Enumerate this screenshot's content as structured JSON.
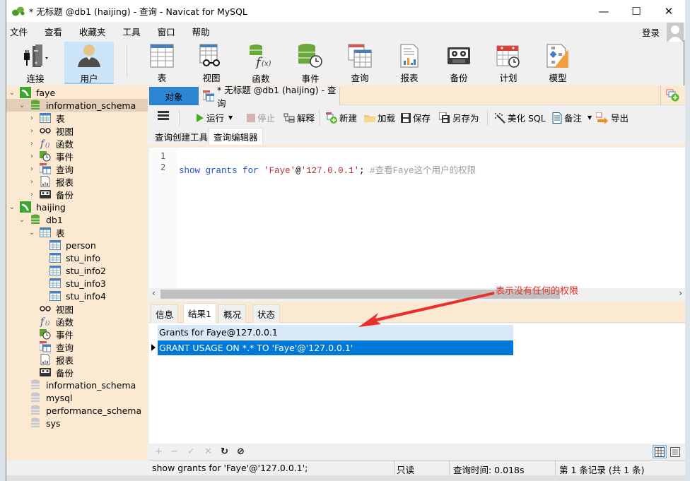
{
  "window": {
    "title": "* 无标题 @db1 (haijing) - 查询 - Navicat for MySQL",
    "controls": {
      "minimize": "—",
      "maximize": "☐",
      "close": "✕"
    }
  },
  "menubar": {
    "items": [
      "文件",
      "查看",
      "收藏夹",
      "工具",
      "窗口",
      "帮助"
    ],
    "login": "登录"
  },
  "toolbar": {
    "buttons": [
      {
        "label": "连接",
        "icon": "connection-icon"
      },
      {
        "label": "用户",
        "icon": "user-icon",
        "active": true
      },
      {
        "label": "表",
        "icon": "table-icon"
      },
      {
        "label": "视图",
        "icon": "view-icon"
      },
      {
        "label": "函数",
        "icon": "function-icon"
      },
      {
        "label": "事件",
        "icon": "event-icon"
      },
      {
        "label": "查询",
        "icon": "query-icon"
      },
      {
        "label": "报表",
        "icon": "report-icon"
      },
      {
        "label": "备份",
        "icon": "backup-icon"
      },
      {
        "label": "计划",
        "icon": "schedule-icon"
      },
      {
        "label": "模型",
        "icon": "model-icon"
      }
    ]
  },
  "sidebar": {
    "tree": [
      {
        "label": "faye",
        "type": "connection",
        "expanded": true
      },
      {
        "label": "information_schema",
        "type": "database",
        "expanded": true,
        "selected": true
      },
      {
        "label": "表",
        "type": "tables"
      },
      {
        "label": "视图",
        "type": "views"
      },
      {
        "label": "函数",
        "type": "functions"
      },
      {
        "label": "事件",
        "type": "events"
      },
      {
        "label": "查询",
        "type": "queries"
      },
      {
        "label": "报表",
        "type": "reports"
      },
      {
        "label": "备份",
        "type": "backups"
      },
      {
        "label": "haijing",
        "type": "connection",
        "expanded": true
      },
      {
        "label": "db1",
        "type": "database",
        "expanded": true
      },
      {
        "label": "表",
        "type": "tables",
        "expanded": true
      },
      {
        "label": "person",
        "type": "table"
      },
      {
        "label": "stu_info",
        "type": "table"
      },
      {
        "label": "stu_info2",
        "type": "table"
      },
      {
        "label": "stu_info3",
        "type": "table"
      },
      {
        "label": "stu_info4",
        "type": "table"
      },
      {
        "label": "视图",
        "type": "views"
      },
      {
        "label": "函数",
        "type": "functions"
      },
      {
        "label": "事件",
        "type": "events"
      },
      {
        "label": "查询",
        "type": "queries"
      },
      {
        "label": "报表",
        "type": "reports"
      },
      {
        "label": "备份",
        "type": "backups"
      },
      {
        "label": "information_schema",
        "type": "database-closed"
      },
      {
        "label": "mysql",
        "type": "database-closed"
      },
      {
        "label": "performance_schema",
        "type": "database-closed"
      },
      {
        "label": "sys",
        "type": "database-closed"
      }
    ]
  },
  "tabs": {
    "objects": "对象",
    "query_tab": "* 无标题 @db1 (haijing) - 查询"
  },
  "query_toolbar": {
    "run": "运行",
    "stop": "停止",
    "explain": "解释",
    "new": "新建",
    "load": "加载",
    "save": "保存",
    "save_as": "另存为",
    "beautify": "美化 SQL",
    "comment": "备注",
    "export": "导出"
  },
  "subtabs": [
    "查询创建工具",
    "查询编辑器"
  ],
  "editor": {
    "line_numbers": [
      "1",
      "2"
    ],
    "code": {
      "kw1": "show",
      "kw2": "grants",
      "kw3": "for",
      "user": "'Faye'",
      "at": "@",
      "host": "'127.0.0.1'",
      "semi": ";",
      "comment": " #查看Faye这个用户的权限"
    }
  },
  "annotation": "表示没有任何的权限",
  "result_tabs": [
    "信息",
    "结果1",
    "概况",
    "状态"
  ],
  "result_grid": {
    "columns": [
      "Grants for Faye@127.0.0.1"
    ],
    "rows": [
      [
        "GRANT USAGE ON *.* TO 'Faye'@'127.0.0.1'"
      ]
    ]
  },
  "grid_toolbar": {
    "add": "+",
    "remove": "−",
    "apply": "✓",
    "discard": "✕",
    "refresh": "↻",
    "stop": "⊘"
  },
  "statusbar": {
    "sql": "show grants for 'Faye'@'127.0.0.1';",
    "mode": "只读",
    "query_time": "查询时间: 0.018s",
    "record": "第 1 条记录 (共 1 条)"
  },
  "colors": {
    "accent": "#0078d7",
    "tab_active": "#2b85d3",
    "sidebar_bg": "#fbe9d1",
    "annotation": "#e8312a"
  }
}
